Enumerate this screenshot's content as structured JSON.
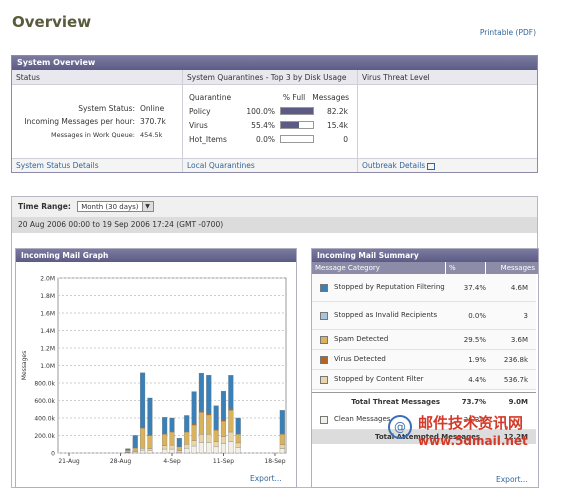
{
  "page": {
    "title": "Overview",
    "printable_link": "Printable (PDF)"
  },
  "system_overview": {
    "header": "System Overview",
    "status": {
      "heading": "Status",
      "rows": [
        {
          "label": "System Status:",
          "value": "Online"
        },
        {
          "label": "Incoming Messages per hour:",
          "value": "370.7k"
        },
        {
          "label": "Messages in Work Queue:",
          "value": "454.5k"
        }
      ],
      "footer_link": "System Status Details"
    },
    "quarantines": {
      "heading": "System Quarantines - Top 3 by Disk Usage",
      "columns": [
        "Quarantine",
        "% Full",
        "Messages"
      ],
      "rows": [
        {
          "name": "Policy",
          "pct": "100.0%",
          "fill": 1.0,
          "messages": "82.2k"
        },
        {
          "name": "Virus",
          "pct": "55.4%",
          "fill": 0.554,
          "messages": "15.4k"
        },
        {
          "name": "Hot_Items",
          "pct": "0.0%",
          "fill": 0.0,
          "messages": "0"
        }
      ],
      "footer_link": "Local Quarantines"
    },
    "virus_threat": {
      "heading": "Virus Threat Level",
      "footer_link": "Outbreak Details"
    }
  },
  "time_range": {
    "label": "Time Range:",
    "selected": "Month (30 days)",
    "date_span": "20 Aug 2006 00:00 to 19 Sep 2006 17:24 (GMT -0700)"
  },
  "graph": {
    "title": "Incoming Mail Graph",
    "export": "Export...",
    "ylabel": "Messages"
  },
  "chart_data": {
    "type": "bar",
    "stacked": true,
    "ylabel": "Messages",
    "ylim": [
      0,
      2000000
    ],
    "y_ticks": [
      "0",
      "200.0k",
      "400.0k",
      "600.0k",
      "800.0k",
      "1.0M",
      "1.2M",
      "1.4M",
      "1.6M",
      "1.8M",
      "2.0M"
    ],
    "x_tick_labels": [
      "21-Aug",
      "28-Aug",
      "4-Sep",
      "11-Sep",
      "18-Sep"
    ],
    "x_tick_day_index": [
      1,
      8,
      15,
      22,
      29
    ],
    "day_count": 31,
    "series": [
      {
        "name": "Clean Messages",
        "color": "#f2f0e6",
        "values": [
          0,
          0,
          0,
          0,
          0,
          0,
          0,
          0,
          0,
          5000,
          12000,
          30000,
          25000,
          0,
          45000,
          45000,
          10000,
          55000,
          80000,
          120000,
          120000,
          70000,
          105000,
          130000,
          60000,
          0,
          0,
          0,
          0,
          0,
          50000
        ]
      },
      {
        "name": "Stopped by Content Filter",
        "color": "#e8d6a8",
        "values": [
          0,
          0,
          0,
          0,
          0,
          0,
          0,
          0,
          0,
          5000,
          10000,
          25000,
          25000,
          0,
          40000,
          45000,
          15000,
          45000,
          60000,
          95000,
          95000,
          60000,
          80000,
          110000,
          55000,
          0,
          0,
          0,
          0,
          0,
          45000
        ]
      },
      {
        "name": "Spam Detected",
        "color": "#d9b25c",
        "values": [
          0,
          0,
          0,
          0,
          0,
          0,
          0,
          0,
          0,
          20000,
          35000,
          230000,
          150000,
          0,
          130000,
          150000,
          45000,
          140000,
          180000,
          250000,
          220000,
          130000,
          180000,
          250000,
          100000,
          0,
          0,
          0,
          0,
          0,
          120000
        ]
      },
      {
        "name": "Virus Detected",
        "color": "#b5651d",
        "values": [
          0,
          0,
          0,
          0,
          0,
          0,
          0,
          0,
          0,
          2000,
          4000,
          12000,
          9000,
          0,
          8000,
          10000,
          3000,
          9000,
          12000,
          18000,
          15000,
          10000,
          12000,
          18000,
          7000,
          0,
          0,
          0,
          0,
          0,
          8000
        ]
      },
      {
        "name": "Stopped as Invalid Recipients",
        "color": "#a8c4dc",
        "values": [
          0,
          0,
          0,
          0,
          0,
          0,
          0,
          0,
          0,
          0,
          0,
          0,
          0,
          0,
          0,
          0,
          0,
          0,
          0,
          0,
          0,
          0,
          0,
          0,
          0,
          0,
          0,
          0,
          0,
          0,
          0
        ]
      },
      {
        "name": "Stopped by Reputation Filtering",
        "color": "#3a7fb5",
        "values": [
          0,
          0,
          0,
          0,
          0,
          0,
          0,
          0,
          0,
          18000,
          140000,
          620000,
          420000,
          0,
          185000,
          150000,
          97000,
          180000,
          370000,
          430000,
          440000,
          270000,
          330000,
          380000,
          178000,
          0,
          0,
          0,
          0,
          0,
          265000
        ]
      }
    ]
  },
  "summary": {
    "title": "Incoming Mail Summary",
    "columns": [
      "Message Category",
      "%",
      "Messages"
    ],
    "rows": [
      {
        "color": "#3a7fb5",
        "label": "Stopped by Reputation Filtering",
        "pct": "37.4%",
        "messages": "4.6M"
      },
      {
        "color": "#a8c4dc",
        "label": "Stopped as Invalid Recipients",
        "pct": "0.0%",
        "messages": "3"
      },
      {
        "color": "#d9b25c",
        "label": "Spam Detected",
        "pct": "29.5%",
        "messages": "3.6M"
      },
      {
        "color": "#b5651d",
        "label": "Virus Detected",
        "pct": "1.9%",
        "messages": "236.8k"
      },
      {
        "color": "#e8d6a8",
        "label": "Stopped by Content Filter",
        "pct": "4.4%",
        "messages": "536.7k"
      }
    ],
    "total_threat": {
      "label": "Total Threat Messages",
      "pct": "73.7%",
      "messages": "9.0M"
    },
    "clean": {
      "color": "#f2f0e6",
      "label": "Clean Messages",
      "pct": "26.3%",
      "messages": ""
    },
    "total_attempted": {
      "label": "Total Attempted Messages",
      "messages": "12.2M"
    },
    "export": "Export..."
  },
  "watermark": {
    "title": "邮件技术资讯网",
    "url": "www.5dmail.net"
  }
}
